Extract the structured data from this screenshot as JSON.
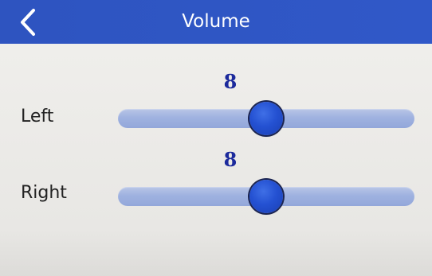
{
  "header": {
    "title": "Volume",
    "back_icon": "chevron-left-icon"
  },
  "channels": [
    {
      "label": "Left",
      "value": "8",
      "level": 0.5
    },
    {
      "label": "Right",
      "value": "8",
      "level": 0.5
    }
  ],
  "colors": {
    "header_bg": "#3058c8",
    "track": "#9fb2e0",
    "knob": "#2451d2",
    "value_text": "#1c2a9c"
  }
}
